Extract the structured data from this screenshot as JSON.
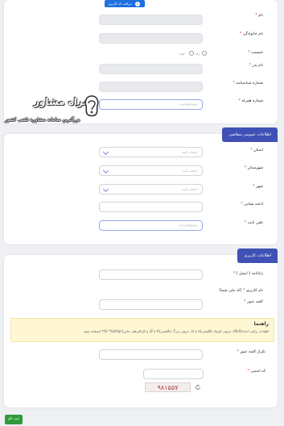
{
  "personal": {
    "fetch_button": "دریافت کد کاربری",
    "name_label": "نام",
    "surname_label": "نام خانوادگی",
    "gender_label": "جنسیت",
    "gender_male": "مرد",
    "gender_female": "زن",
    "father_label": "نام پدر",
    "idcard_label": "شماره شناسنامه",
    "mobile_label": "شماره همراه",
    "mobile_placeholder": "۰۹۱۲۳۴۵۶۷۸۹"
  },
  "contact": {
    "section_title": "اطلاعات عمومی متقاضی",
    "province_label": "استان",
    "province_placeholder": "انتخاب کنید",
    "county_label": "شهرستان",
    "county_placeholder": "انتخاب کنید",
    "city_label": "شهر",
    "city_placeholder": "انتخاب کنید",
    "address_label": "ادامه نشانی",
    "phone_label": "تلفن ثابت",
    "phone_placeholder": "۰۲۱۱۲۳۴۵۶۷۸"
  },
  "account": {
    "section_title": "اطلاعات کاربری",
    "email_label": "رایانامه ( ایمیل )",
    "username_label": "نام کاربری",
    "username_note": "(کد ملی شما)",
    "password_label": "کلمه عبور",
    "hint_title": "راهنما",
    "hint_text": "لطفا از ترکیب اعداد(0تا9)، حروف کوچک انگلیسی(a تا z)، حروف بزرگ انگلیسی(A تا Z) و کاراکترهای خاص(!@#$%^&*) استفاده شود",
    "confirm_label": "تکرار کلمه عبور",
    "captcha_label": "کد امنیتی",
    "captcha_text": "۹۸۱۵۵۷",
    "submit": "ثبت نام"
  },
  "watermark": {
    "title": "همراه مشاور",
    "subtitle": "بزرگترین سامانه مشاوره تلفنی کشور"
  },
  "colors": {
    "section_tab": "#3f51b5",
    "fetch_button": "#1e6fe0",
    "submit_button": "#2e9a3a",
    "required": "#e53935",
    "hint_bg": "#fff6d4"
  }
}
